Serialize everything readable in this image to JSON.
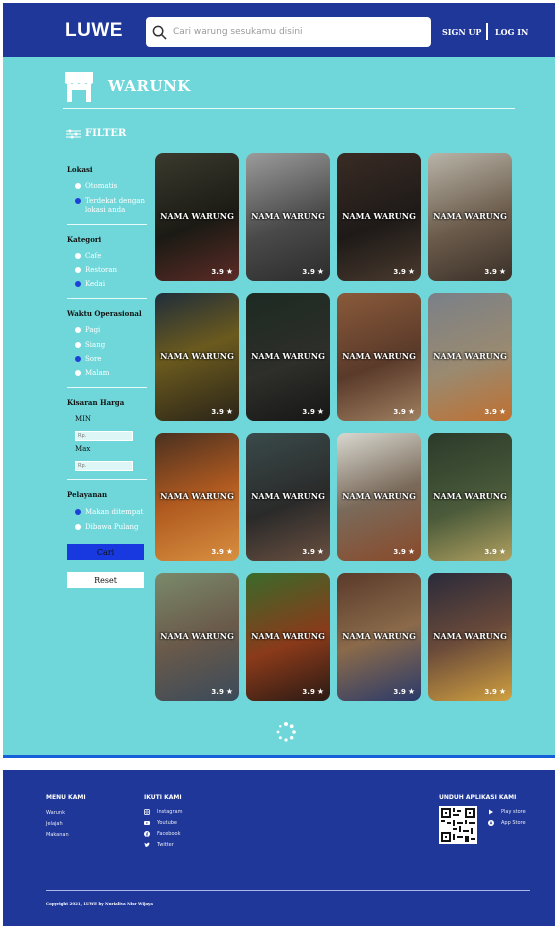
{
  "header": {
    "brand": "LUWE",
    "search_placeholder": "Cari warung sesukamu disini",
    "signup": "SIGN UP",
    "login": "LOG IN"
  },
  "page": {
    "title": "WARUNK",
    "filter_label": "FILTER"
  },
  "filter": {
    "lokasi": {
      "title": "Lokasi",
      "options": [
        {
          "label": "Otomatis",
          "selected": false
        },
        {
          "label": "Terdekat dengan lokasi anda",
          "selected": true
        }
      ]
    },
    "kategori": {
      "title": "Kategori",
      "options": [
        {
          "label": "Cafe",
          "selected": false
        },
        {
          "label": "Restoran",
          "selected": false
        },
        {
          "label": "Kedai",
          "selected": true
        }
      ]
    },
    "waktu": {
      "title": "Waktu Operasional",
      "options": [
        {
          "label": "Pagi",
          "selected": false
        },
        {
          "label": "Siang",
          "selected": false
        },
        {
          "label": "Sore",
          "selected": true
        },
        {
          "label": "Malam",
          "selected": false
        }
      ]
    },
    "harga": {
      "title": "Kisaran Harga",
      "min_label": "MIN",
      "max_label": "Max",
      "min_placeholder": "Rp.",
      "max_placeholder": "Rp."
    },
    "pelayanan": {
      "title": "Pelayanan",
      "options": [
        {
          "label": "Makan ditempat",
          "selected": true
        },
        {
          "label": "Dibawa Pulang",
          "selected": false
        }
      ]
    },
    "cari_label": "Cari",
    "reset_label": "Reset"
  },
  "warungs": [
    {
      "name": "NAMA WARUNG",
      "rating": "3.9"
    },
    {
      "name": "NAMA WARUNG",
      "rating": "3.9"
    },
    {
      "name": "NAMA WARUNG",
      "rating": "3.9"
    },
    {
      "name": "NAMA WARUNG",
      "rating": "3.9"
    },
    {
      "name": "NAMA WARUNG",
      "rating": "3.9"
    },
    {
      "name": "NAMA WARUNG",
      "rating": "3.9"
    },
    {
      "name": "NAMA WARUNG",
      "rating": "3.9"
    },
    {
      "name": "NAMA WARUNG",
      "rating": "3.9"
    },
    {
      "name": "NAMA WARUNG",
      "rating": "3.9"
    },
    {
      "name": "NAMA WARUNG",
      "rating": "3.9"
    },
    {
      "name": "NAMA WARUNG",
      "rating": "3.9"
    },
    {
      "name": "NAMA WARUNG",
      "rating": "3.9"
    },
    {
      "name": "NAMA WARUNG",
      "rating": "3.9"
    },
    {
      "name": "NAMA WARUNG",
      "rating": "3.9"
    },
    {
      "name": "NAMA WARUNG",
      "rating": "3.9"
    },
    {
      "name": "NAMA WARUNG",
      "rating": "3.9"
    }
  ],
  "footer": {
    "menu_title": "MENU KAMI",
    "menu_items": [
      "Warunk",
      "Jelajah",
      "Makanan"
    ],
    "follow_title": "IKUTI KAMI",
    "social": [
      {
        "label": "Instagram",
        "icon": "instagram-icon"
      },
      {
        "label": "Youtube",
        "icon": "youtube-icon"
      },
      {
        "label": "Facebook",
        "icon": "facebook-icon"
      },
      {
        "label": "Twitter",
        "icon": "twitter-icon"
      }
    ],
    "app_title": "UNDUH APLIKASI KAMI",
    "stores": [
      {
        "label": "Play store",
        "icon": "play-store-icon"
      },
      {
        "label": "App Store",
        "icon": "app-store-icon"
      }
    ],
    "copyright": "Copyright 2021, LUWE by Nurialiva Nisr Wijaya"
  },
  "colors": {
    "header": "#1e3799",
    "main_bg": "#6fd7d9",
    "accent": "#1939e0",
    "footer": "#1e3799"
  }
}
